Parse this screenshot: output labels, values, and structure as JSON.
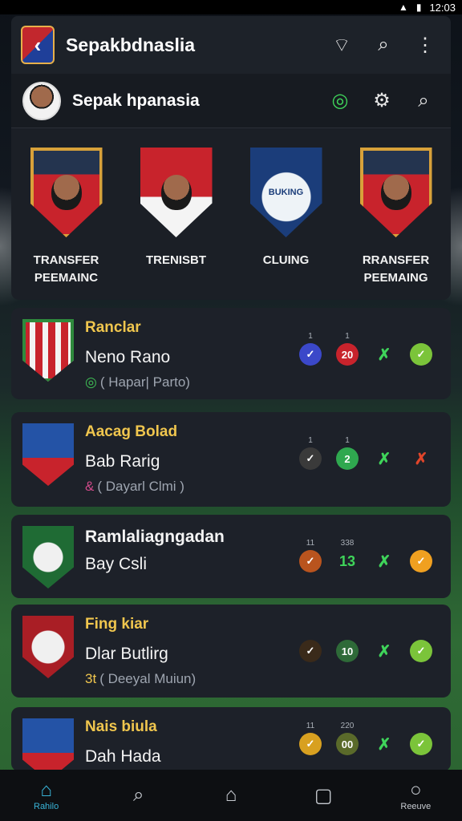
{
  "status": {
    "time": "12:03"
  },
  "appbar": {
    "title": "Sepakbdnaslia"
  },
  "subbar": {
    "title": "Sepak hpanasia"
  },
  "featured": [
    {
      "label": "TRANSFER\nPEEMAINC",
      "crest": "player-red"
    },
    {
      "label": "TRENISBT",
      "crest": "player-white"
    },
    {
      "label": "CLUING",
      "crest_text": "BUKING",
      "crest": "club-blue"
    },
    {
      "label": "RRANSFER\nPEEMAING",
      "crest": "player-red"
    }
  ],
  "cards": [
    {
      "league": "Ranclar",
      "name": "Neno Rano",
      "sub_symbol": "◎",
      "sub": "( Hapar| Parto)",
      "stats": [
        {
          "top": "1",
          "text": "✓",
          "color": "#3b48c9"
        },
        {
          "top": "1",
          "text": "20",
          "color": "#c8232c"
        },
        {
          "top": "",
          "text": "✗",
          "color": "none"
        },
        {
          "top": "",
          "text": "✓",
          "color": "#7bc43a"
        }
      ]
    },
    {
      "league": "Aacag Bolad",
      "name": "Bab Rarig",
      "sub_symbol": "&",
      "sub": "( Dayarl Clmi )",
      "stats": [
        {
          "top": "1",
          "text": "✓",
          "color": "#3a3a3a"
        },
        {
          "top": "1",
          "text": "2",
          "color": "#2fa84f"
        },
        {
          "top": "",
          "text": "✗",
          "color": "none"
        },
        {
          "top": "",
          "text": "✗",
          "color": "none-red"
        }
      ]
    },
    {
      "league": "",
      "name_line1": "Ramlaliagngadan",
      "name": "Bay Csli",
      "sub_symbol": "",
      "sub": "",
      "stats": [
        {
          "top": "11",
          "text": "✓",
          "color": "#b9541e"
        },
        {
          "top": "338",
          "text": "13",
          "color": "none-green"
        },
        {
          "top": "",
          "text": "✗",
          "color": "none"
        },
        {
          "top": "",
          "text": "✓",
          "color": "#f0a020"
        }
      ]
    },
    {
      "league": "Fing kiar",
      "name": "Dlar Butlirg",
      "sub_symbol": "3t",
      "sub": "( Deeyal Muiun)",
      "stats": [
        {
          "top": "",
          "text": "✓",
          "color": "#3a2a1a"
        },
        {
          "top": "",
          "text": "10",
          "color": "#2e6a38"
        },
        {
          "top": "",
          "text": "✗",
          "color": "none"
        },
        {
          "top": "",
          "text": "✓",
          "color": "#7bc43a"
        }
      ]
    },
    {
      "league": "Nais biula",
      "name": "Dah Hada",
      "sub_symbol": "",
      "sub": "",
      "stats": [
        {
          "top": "11",
          "text": "✓",
          "color": "#d8a020"
        },
        {
          "top": "220",
          "text": "00",
          "color": "#5a6a2a"
        },
        {
          "top": "",
          "text": "✗",
          "color": "none"
        },
        {
          "top": "",
          "text": "✓",
          "color": "#7bc43a"
        }
      ]
    }
  ],
  "bottomnav": [
    {
      "label": "Rahilo",
      "icon": "home-icon",
      "active": true
    },
    {
      "label": "",
      "icon": "search-icon"
    },
    {
      "label": "",
      "icon": "house-outline-icon"
    },
    {
      "label": "",
      "icon": "square-icon"
    },
    {
      "label": "Reeuve",
      "icon": "profile-icon"
    }
  ],
  "colors": {
    "accent": "#39b4d8",
    "gold": "#f0c64e",
    "card": "#1d2129"
  }
}
